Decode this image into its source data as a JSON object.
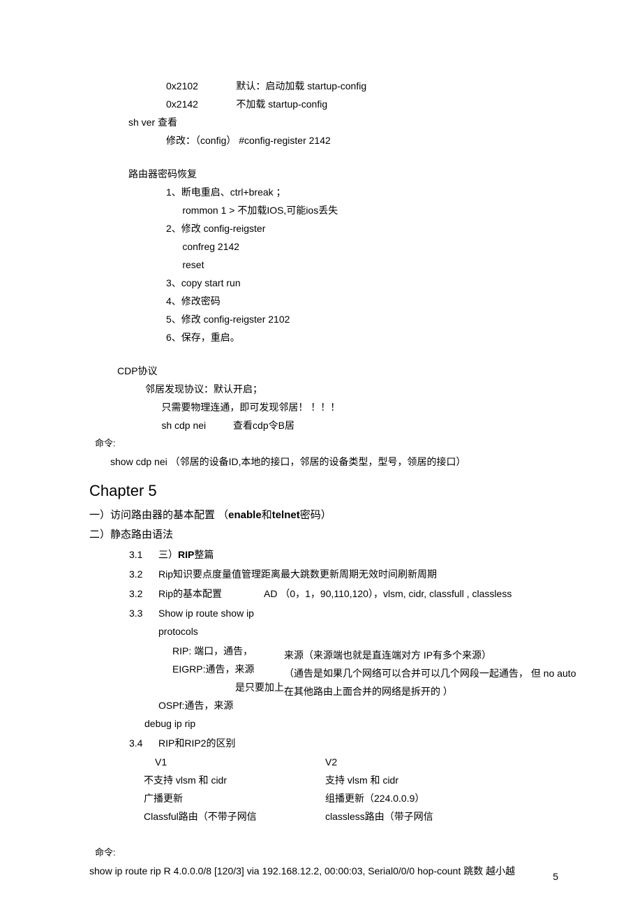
{
  "reg_rows": [
    [
      "0x2102",
      "默认：启动加载 startup-config"
    ],
    [
      "0x2142",
      "不加载 startup-config"
    ]
  ],
  "shver": "sh ver 查看",
  "modify": "修改：（config） #config-register 2142",
  "pw_recovery_title": "路由器密码恢复",
  "pw_steps": [
    "1、断电重启、ctrl+break ；",
    "      rommon 1 > 不加载IOS,可能ios丢失",
    "2、修改 config-reigster",
    "      confreg 2142",
    "      reset",
    "3、copy start run",
    "4、修改密码",
    "5、修改 config-reigster 2102",
    "6、保存，重启。"
  ],
  "cdp_title": "CDP协议",
  "cdp_lines": [
    "邻居发现协议：默认开启；",
    "      只需要物理连通，即可发现邻居！ ！！！",
    "      sh cdp nei          查看cdp令B居"
  ],
  "cmd_label": "命令:",
  "show_cdp": "show cdp nei （邻居的设备ID,本地的接口，邻居的设备类型，型号，领居的接口）",
  "chapter5": "Chapter 5",
  "sect1_prefix": "一）访问路由器的基本配置   （",
  "sect1_bold1": "enable",
  "sect1_mid": "和",
  "sect1_bold2": "telnet",
  "sect1_suffix": "密码）",
  "sect2": "二）静态路由语法",
  "sect3_prefix": "三）",
  "sect3_bold": "RIP",
  "sect3_suffix": "整篇",
  "num31": "3.1",
  "num32": "3.2",
  "num32b": "3.2",
  "num33": "3.3",
  "num34": "3.4",
  "rip_kb": "Rip知识要点度量值管理距离最大跳数更新周期无效时间刷新周期",
  "rip_basic": "Rip的基本配置",
  "rip_ad": "AD （0，1，90,110,120），vlsm, cidr, classfull , classless",
  "showiproute": "Show ip route show ip protocols",
  "rip_port": "RIP: 端口，通告，",
  "eigrp_line": "EIGRP:通告，来源",
  "eigrp_sub": "是只要加上",
  "ospf_line": "OSPf:通告，来源",
  "laiyuan1": "来源（来源端也就是直连端对方 IP有多个来源）",
  "laiyuan2": "（通告是如果几个网络可以合并可以几个网段一起通告， 但 no auto",
  "laiyuan3": "在其他路由上面合并的网络是拆开的 ）",
  "debug": "debug ip rip",
  "rip_diff_title": "RIP和RIP2的区别",
  "v1h": "V1",
  "v2h": "V2",
  "row1a": "不支持 vlsm 和 cidr",
  "row1b": "支持 vlsm 和 cidr",
  "row2a": "广播更新",
  "row2b": "组播更新（224.0.0.9）",
  "row3a": "Classful路由（不带子网信",
  "row3b": "classless路由（带子网信",
  "cmd_label2": "命令:",
  "show_rip_line": "show ip route rip R 4.0.0.0/8 [120/3] via 192.168.12.2, 00:00:03, Serial0/0/0 hop-count 跳数  越小越",
  "page_num": "5"
}
